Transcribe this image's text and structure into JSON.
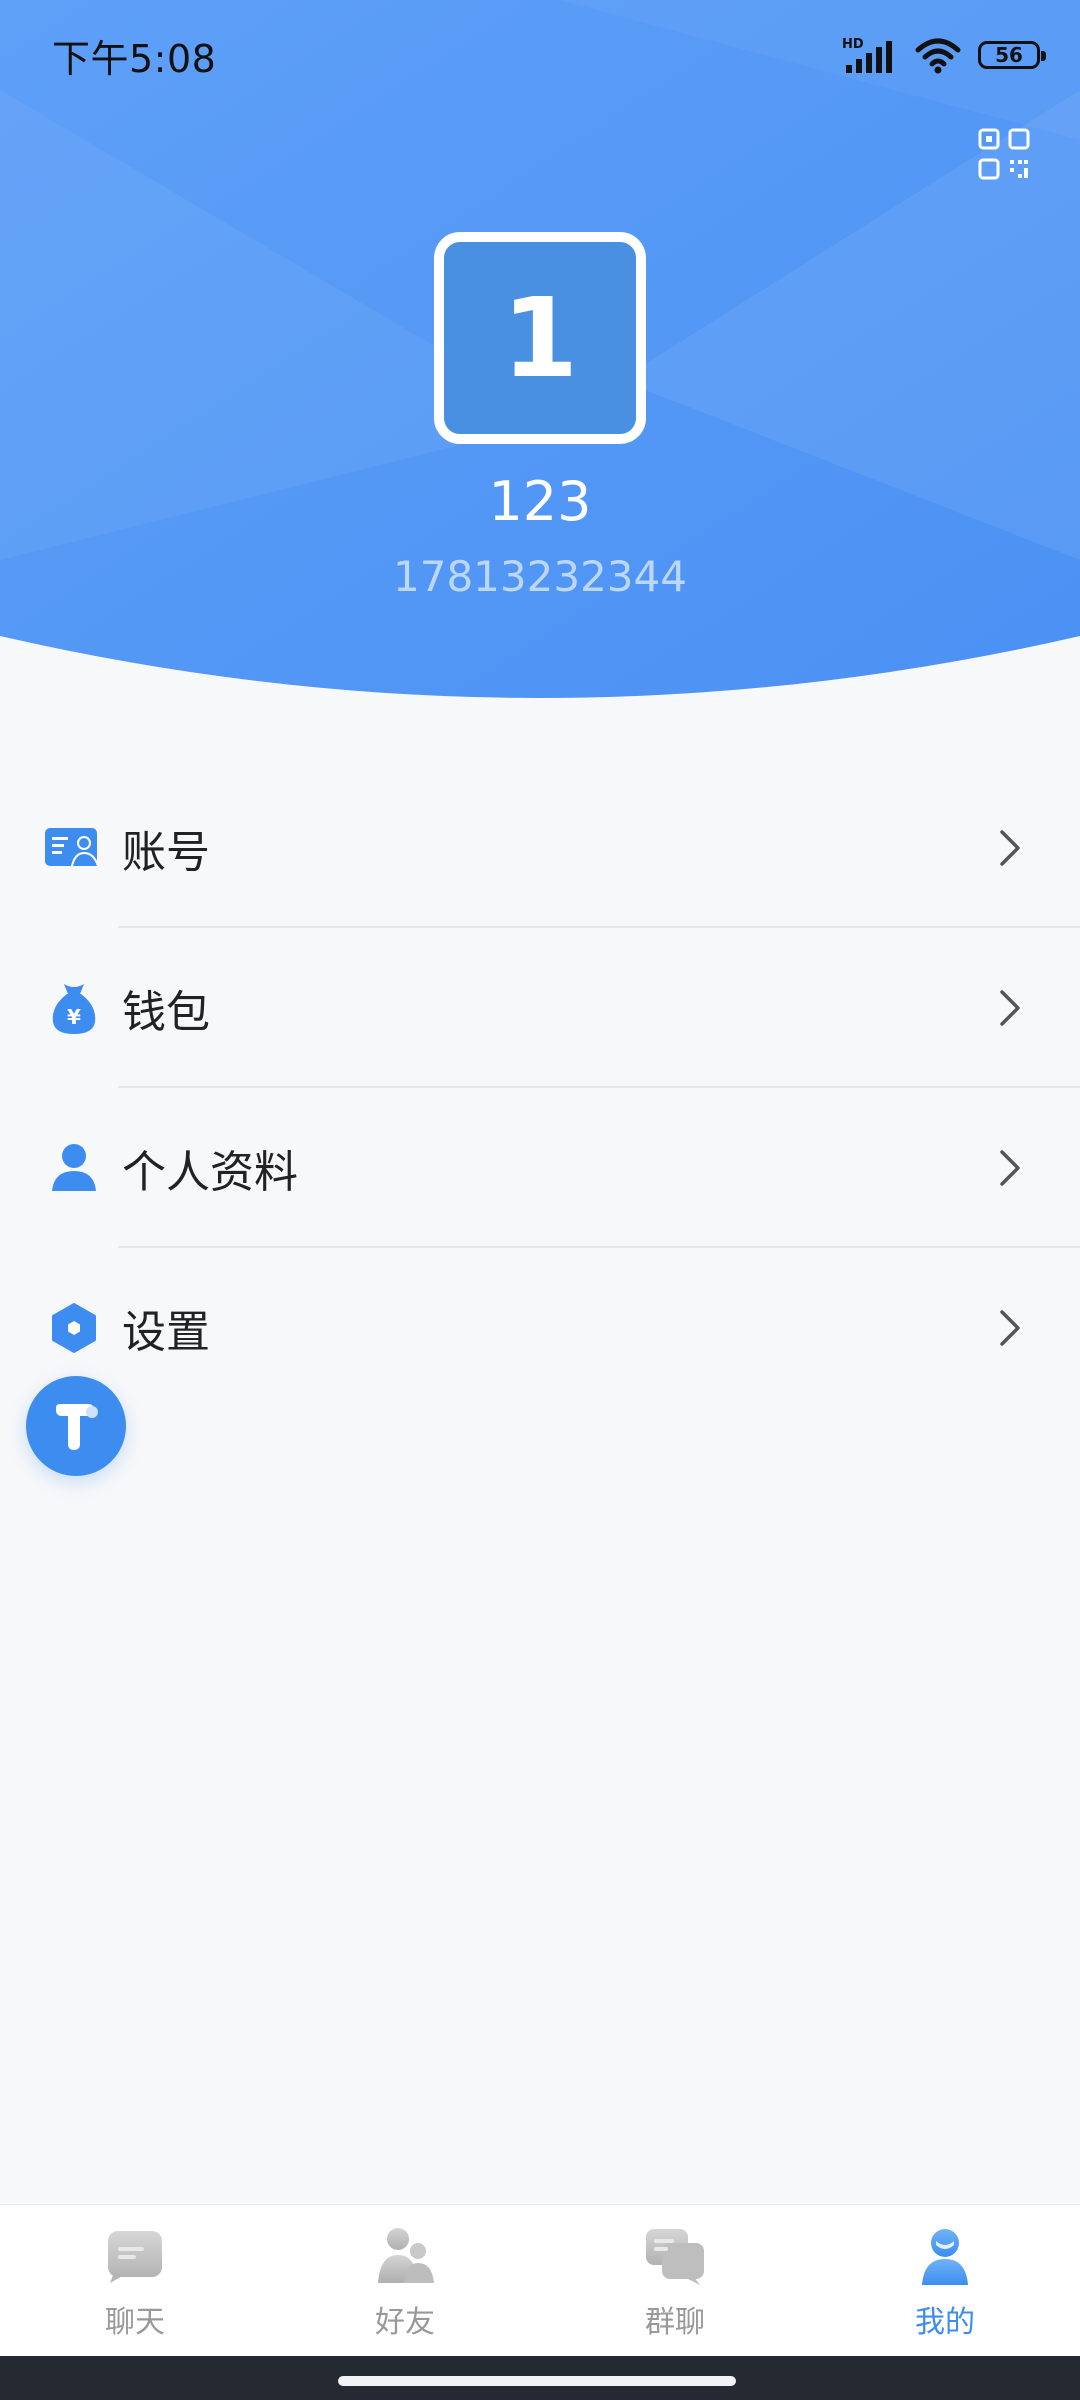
{
  "status_bar": {
    "time": "下午5:08",
    "network_label": "HD",
    "battery_level": "56"
  },
  "profile": {
    "avatar_text": "1",
    "name": "123",
    "phone": "17813232344"
  },
  "menu": {
    "items": [
      {
        "label": "账号",
        "icon": "id-card-icon"
      },
      {
        "label": "钱包",
        "icon": "money-bag-icon"
      },
      {
        "label": "个人资料",
        "icon": "person-icon"
      },
      {
        "label": "设置",
        "icon": "settings-hexagon-icon"
      }
    ]
  },
  "tabbar": {
    "tabs": [
      {
        "label": "聊天",
        "icon": "chat-icon",
        "active": false
      },
      {
        "label": "好友",
        "icon": "friends-icon",
        "active": false
      },
      {
        "label": "群聊",
        "icon": "group-chat-icon",
        "active": false
      },
      {
        "label": "我的",
        "icon": "me-icon",
        "active": true
      }
    ]
  },
  "colors": {
    "header_gradient_start": "#5EA0F8",
    "header_gradient_end": "#4E93F5",
    "accent": "#3D8DF0",
    "avatar_bg": "#4A90E2",
    "page_bg": "#F7F8FA",
    "inactive_tab": "#999999"
  }
}
